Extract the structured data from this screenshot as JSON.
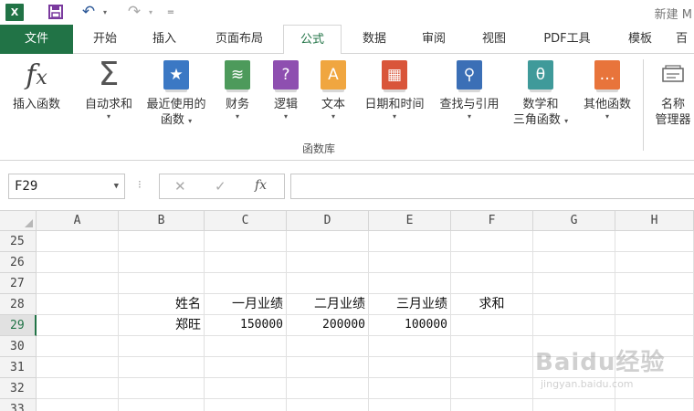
{
  "app": {
    "logo_text": "X",
    "title": "新建 M"
  },
  "quick_access": {
    "undo": "↶",
    "redo": "↷",
    "dropdown": "▾",
    "customize": "="
  },
  "tabs": [
    "文件",
    "开始",
    "插入",
    "页面布局",
    "公式",
    "数据",
    "审阅",
    "视图",
    "PDF工具",
    "模板",
    "百"
  ],
  "ribbon": {
    "group_label": "函数库",
    "buttons": [
      {
        "label": "插入函数",
        "icon": "fx-icon"
      },
      {
        "label": "自动求和",
        "icon": "sigma-icon",
        "has_caret": true
      },
      {
        "label": "最近使用的",
        "label2": "函数",
        "icon": "star-book-icon",
        "color": "#3b78c4",
        "has_caret": true
      },
      {
        "label": "财务",
        "icon": "coins-book-icon",
        "color": "#4d9a5b",
        "has_caret": true
      },
      {
        "label": "逻辑",
        "icon": "question-book-icon",
        "color": "#8e4fb0",
        "has_caret": true
      },
      {
        "label": "文本",
        "icon": "text-book-icon",
        "color": "#f0a640",
        "has_caret": true
      },
      {
        "label": "日期和时间",
        "icon": "calendar-book-icon",
        "color": "#d9553a",
        "has_caret": true
      },
      {
        "label": "查找与引用",
        "icon": "magnifier-book-icon",
        "color": "#3b6fb6",
        "has_caret": true
      },
      {
        "label": "数学和",
        "label2": "三角函数",
        "icon": "theta-book-icon",
        "color": "#3f9a9a",
        "has_caret": true
      },
      {
        "label": "其他函数",
        "icon": "more-book-icon",
        "color": "#e8743b",
        "has_caret": true
      },
      {
        "label": "名称",
        "label2": "管理器",
        "icon": "name-manager-icon"
      }
    ]
  },
  "formula_bar": {
    "name_box": "F29",
    "formula": ""
  },
  "grid": {
    "columns": [
      "A",
      "B",
      "C",
      "D",
      "E",
      "F",
      "G",
      "H"
    ],
    "rows": [
      "25",
      "26",
      "27",
      "28",
      "29",
      "30",
      "31",
      "32",
      "33"
    ],
    "selected_row": "29",
    "cells": {
      "B28": "姓名",
      "C28": "一月业绩",
      "D28": "二月业绩",
      "E28": "三月业绩",
      "F28": "求和",
      "B29": "郑旺",
      "C29": "150000",
      "D29": "200000",
      "E29": "100000"
    }
  },
  "watermark": {
    "logo": "Baidu经验",
    "url": "jingyan.baidu.com"
  }
}
